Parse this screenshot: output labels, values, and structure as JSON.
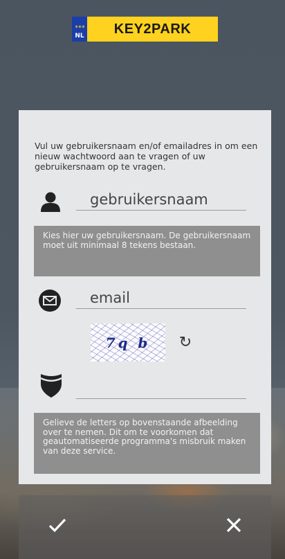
{
  "logo": {
    "country_code": "NL",
    "brand": "KEY2PARK"
  },
  "intro_text": "Vul uw gebruikersnaam en/of emailadres in om een nieuw wachtwoord aan te vragen of uw gebruikersnaam op te vragen.",
  "username": {
    "placeholder": "gebruikersnaam",
    "icon": "user-icon"
  },
  "username_hint": "Kies hier uw gebruikersnaam. De gebruikersnaam moet uit minimaal 8 tekens bestaan.",
  "email": {
    "placeholder": "email",
    "icon": "envelope-icon"
  },
  "captcha": {
    "image_text": "7q b",
    "refresh_icon": "refresh-icon",
    "input_icon": "shield-icon",
    "value": ""
  },
  "captcha_hint": "Gelieve de letters op bovenstaande afbeelding over te nemen. Dit om te voorkomen dat geautomatiseerde programma's misbruik maken van deze service.",
  "actions": {
    "confirm_icon": "checkmark-icon",
    "cancel_icon": "close-icon"
  },
  "colors": {
    "logo_yellow": "#ffd21f",
    "eu_blue": "#1b3ea8",
    "card": "#e6e7e8",
    "hint_bg": "#8f8f8f"
  }
}
